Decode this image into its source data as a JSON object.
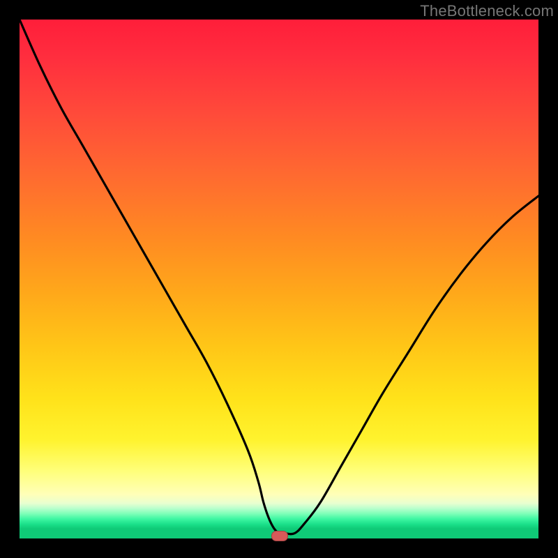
{
  "watermark": "TheBottleneck.com",
  "colors": {
    "frame": "#000000",
    "gradient_top": "#ff1e3a",
    "gradient_bottom": "#0fca77",
    "curve": "#000000",
    "marker": "#d85a59"
  },
  "chart_data": {
    "type": "line",
    "title": "",
    "xlabel": "",
    "ylabel": "",
    "xlim": [
      0,
      100
    ],
    "ylim": [
      0,
      100
    ],
    "series": [
      {
        "name": "bottleneck-curve",
        "x": [
          0,
          4,
          8,
          12,
          16,
          20,
          24,
          28,
          32,
          36,
          40,
          44,
          46,
          47,
          48,
          49,
          50,
          51,
          53,
          55,
          58,
          62,
          66,
          70,
          75,
          80,
          85,
          90,
          95,
          100
        ],
        "y": [
          100,
          91,
          83,
          76,
          69,
          62,
          55,
          48,
          41,
          34,
          26,
          17,
          11,
          7,
          4,
          2,
          1,
          1,
          1,
          3,
          7,
          14,
          21,
          28,
          36,
          44,
          51,
          57,
          62,
          66
        ]
      }
    ],
    "annotations": [
      {
        "name": "optimal-marker",
        "x": 50,
        "y": 0.5
      }
    ],
    "background_gradient": {
      "orientation": "vertical",
      "stops": [
        {
          "pos": 0.0,
          "color": "#ff1e3a"
        },
        {
          "pos": 0.3,
          "color": "#ff6a30"
        },
        {
          "pos": 0.6,
          "color": "#ffc617"
        },
        {
          "pos": 0.85,
          "color": "#fff87a"
        },
        {
          "pos": 0.95,
          "color": "#40f7a3"
        },
        {
          "pos": 1.0,
          "color": "#0fca77"
        }
      ]
    }
  }
}
